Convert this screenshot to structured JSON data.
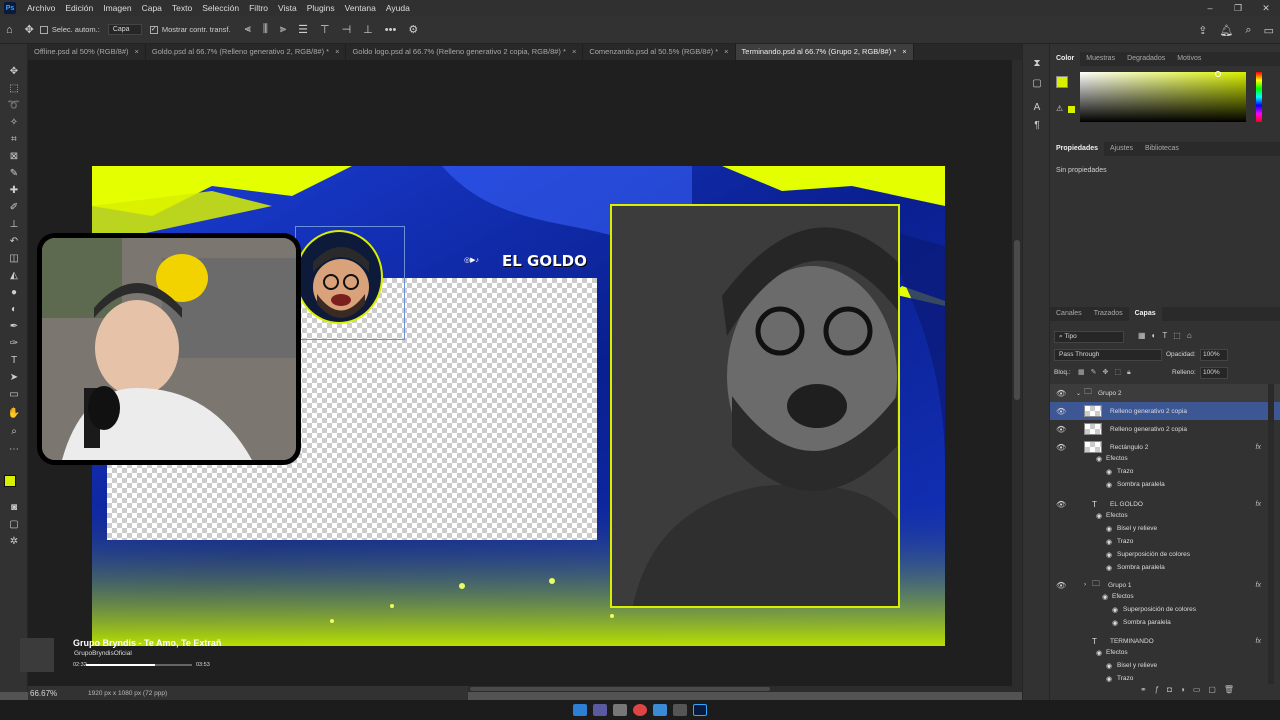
{
  "menu": [
    "Archivo",
    "Edición",
    "Imagen",
    "Capa",
    "Texto",
    "Selección",
    "Filtro",
    "Vista",
    "Plugins",
    "Ventana",
    "Ayuda"
  ],
  "options": {
    "auto_select": "Selec. autom.:",
    "layer_select": "Capa",
    "show_transform": "Mostrar contr. transf."
  },
  "tabs": [
    {
      "label": "Offline.psd al 50% (RGB/8#)"
    },
    {
      "label": "Goldo.psd al 66.7% (Relleno generativo 2, RGB/8#) *"
    },
    {
      "label": "Goldo logo.psd al 66.7% (Relleno generativo 2 copia, RGB/8#) *"
    },
    {
      "label": "Comenzando.psd al 50.5% (RGB/8#) *"
    },
    {
      "label": "Terminando.psd al 66.7% (Grupo 2, RGB/8#) *"
    }
  ],
  "artwork": {
    "brand": "EL GOLDO",
    "social_icons": "◎▶♪"
  },
  "status": {
    "zoom": "66.67%",
    "doc_info": "1920 px x 1080 px (72 ppp)"
  },
  "media": {
    "title": "Grupo Bryndis - Te Amo, Te Extrañ",
    "artist": "GrupoBryndisOficial",
    "elapsed": "02:32",
    "duration": "03:53",
    "progress": 0.65
  },
  "color_panel": {
    "tabs": [
      "Color",
      "Muestras",
      "Degradados",
      "Motivos"
    ],
    "fg_color": "#d8f000",
    "bg_color": "#ffffff"
  },
  "props_panel": {
    "tabs": [
      "Propiedades",
      "Ajustes",
      "Bibliotecas"
    ],
    "empty": "Sin propiedades"
  },
  "layers_panel": {
    "tabs": [
      "Canales",
      "Trazados",
      "Capas"
    ],
    "filter": "Tipo",
    "blend": "Pass Through",
    "opacity_label": "Opacidad:",
    "opacity": "100%",
    "lock_label": "Bloq.:",
    "fill_label": "Relleno:",
    "fill": "100%",
    "rows": [
      {
        "label": "Grupo 2"
      },
      {
        "label": "Relleno generativo 2 copia"
      },
      {
        "label": "Relleno generativo 2 copia"
      },
      {
        "label": "Rectángulo 2"
      },
      {
        "label": "Efectos"
      },
      {
        "label": "Trazo"
      },
      {
        "label": "Sombra paralela"
      },
      {
        "label": "EL GOLDO"
      },
      {
        "label": "Efectos"
      },
      {
        "label": "Bisel y relieve"
      },
      {
        "label": "Trazo"
      },
      {
        "label": "Superposición de colores"
      },
      {
        "label": "Sombra paralela"
      },
      {
        "label": "Grupo 1"
      },
      {
        "label": "Efectos"
      },
      {
        "label": "Superposición de colores"
      },
      {
        "label": "Sombra paralela"
      },
      {
        "label": "TERMINANDO"
      },
      {
        "label": "Efectos"
      },
      {
        "label": "Bisel y relieve"
      },
      {
        "label": "Trazo"
      }
    ]
  }
}
